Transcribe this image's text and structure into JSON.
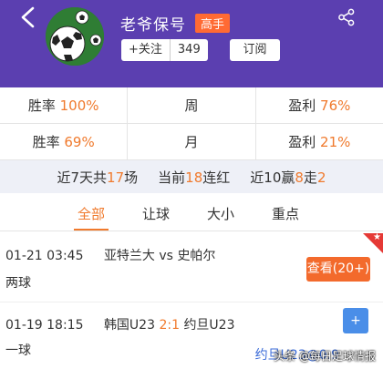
{
  "header": {
    "title": "老爷保号",
    "badge": "高手",
    "follow_label": "+关注",
    "follow_count": "349",
    "subscribe_label": "订阅"
  },
  "stats": [
    {
      "left_label": "胜率",
      "left_value": "100%",
      "period": "周",
      "right_label": "盈利",
      "right_value": "76%"
    },
    {
      "left_label": "胜率",
      "left_value": "69%",
      "period": "月",
      "right_label": "盈利",
      "right_value": "21%"
    }
  ],
  "summary": {
    "recent_prefix": "近7天共",
    "recent_count": "17",
    "recent_suffix": "场",
    "streak_prefix": "当前",
    "streak_count": "18",
    "streak_suffix": "连红",
    "last10_prefix": "近10赢",
    "last10_wins": "8",
    "last10_mid": "走",
    "last10_push": "2"
  },
  "tabs": [
    "全部",
    "让球",
    "大小",
    "重点"
  ],
  "matches": [
    {
      "datetime": "01-21 03:45",
      "home": "亚特兰大",
      "vs": "vs",
      "away": "史帕尔",
      "type": "两球",
      "action": "查看(20+)"
    },
    {
      "datetime": "01-19 18:15",
      "home": "韩国U23",
      "score": "2:1",
      "away": "约旦U23",
      "type": "一球",
      "pick": "约旦U23@0.9"
    }
  ],
  "watermark": "头条 @每日足球情报",
  "colors": {
    "header_bg": "#5b3fb0",
    "accent": "#f07a2d",
    "badge": "#ff6a33"
  }
}
